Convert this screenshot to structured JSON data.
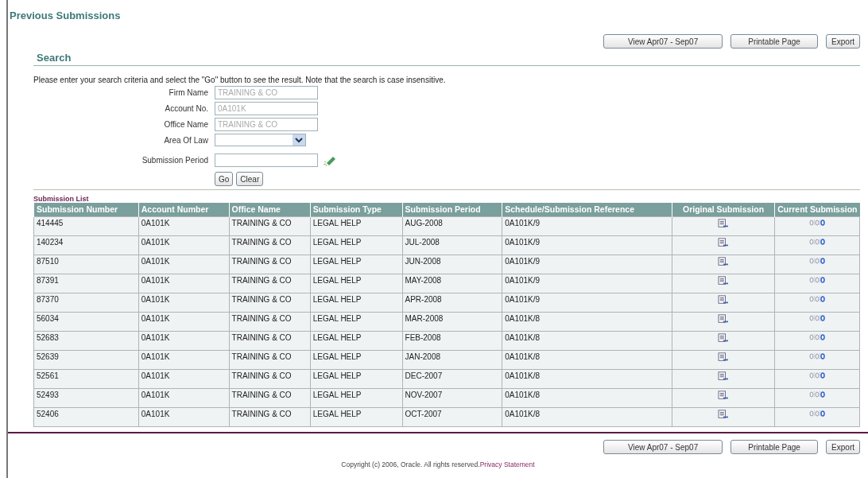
{
  "title": "Previous Submissions",
  "top_buttons": [
    "View Apr07 - Sep07",
    "Printable Page",
    "Export"
  ],
  "search": {
    "heading": "Search",
    "instructions": "Please enter your search criteria and select the \"Go\" button to see the result. Note that the search is case insensitive.",
    "fields": [
      {
        "kind": "text",
        "label": "Firm Name",
        "value": "TRAINING & CO",
        "disabled": true
      },
      {
        "kind": "text",
        "label": "Account No.",
        "value": "0A101K",
        "disabled": true
      },
      {
        "kind": "text",
        "label": "Office Name",
        "value": "TRAINING & CO",
        "disabled": true
      },
      {
        "kind": "select",
        "label": "Area Of Law"
      },
      {
        "kind": "date",
        "label": "Submission Period"
      }
    ],
    "buttons": [
      "Go",
      "Clear"
    ]
  },
  "table": {
    "caption": "Submission List",
    "columns": [
      "Submission Number",
      "Account Number",
      "Office Name",
      "Submission Type",
      "Submission Period",
      "Schedule/Submission Reference",
      "Original Submission",
      "Current Submission"
    ],
    "rows": [
      [
        "414445",
        "0A101K",
        "TRAINING & CO",
        "LEGAL HELP",
        "AUG-2008",
        "0A101K/9"
      ],
      [
        "140234",
        "0A101K",
        "TRAINING & CO",
        "LEGAL HELP",
        "JUL-2008",
        "0A101K/9"
      ],
      [
        "87510",
        "0A101K",
        "TRAINING & CO",
        "LEGAL HELP",
        "JUN-2008",
        "0A101K/9"
      ],
      [
        "87391",
        "0A101K",
        "TRAINING & CO",
        "LEGAL HELP",
        "MAY-2008",
        "0A101K/9"
      ],
      [
        "87370",
        "0A101K",
        "TRAINING & CO",
        "LEGAL HELP",
        "APR-2008",
        "0A101K/9"
      ],
      [
        "56034",
        "0A101K",
        "TRAINING & CO",
        "LEGAL HELP",
        "MAR-2008",
        "0A101K/8"
      ],
      [
        "52683",
        "0A101K",
        "TRAINING & CO",
        "LEGAL HELP",
        "FEB-2008",
        "0A101K/8"
      ],
      [
        "52639",
        "0A101K",
        "TRAINING & CO",
        "LEGAL HELP",
        "JAN-2008",
        "0A101K/8"
      ],
      [
        "52561",
        "0A101K",
        "TRAINING & CO",
        "LEGAL HELP",
        "DEC-2007",
        "0A101K/8"
      ],
      [
        "52493",
        "0A101K",
        "TRAINING & CO",
        "LEGAL HELP",
        "NOV-2007",
        "0A101K/8"
      ],
      [
        "52406",
        "0A101K",
        "TRAINING & CO",
        "LEGAL HELP",
        "OCT-2007",
        "0A101K/8"
      ]
    ]
  },
  "bottom_buttons": [
    "View Apr07 - Sep07",
    "Printable Page",
    "Export"
  ],
  "footer": {
    "copyright": "Copyright (c) 2006, Oracle. All rights reserved.",
    "link": "Privacy Statement"
  }
}
